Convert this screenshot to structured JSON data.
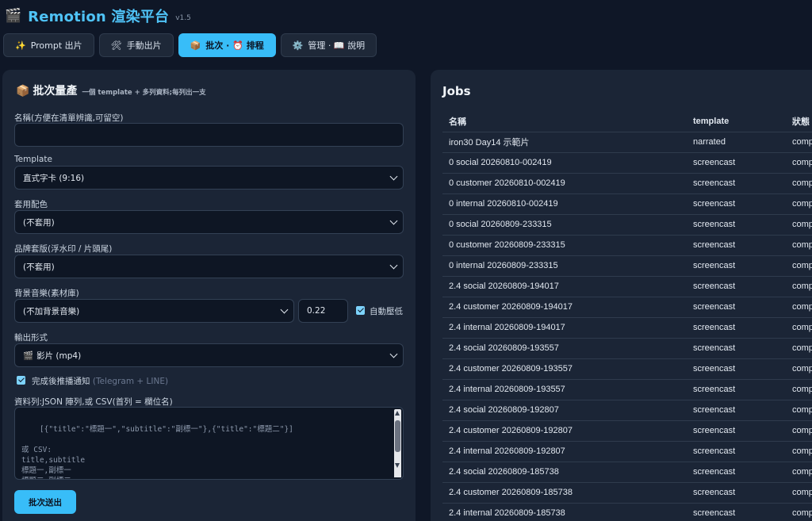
{
  "app": {
    "logo_icon": "🎬",
    "title": "Remotion 渲染平台",
    "version": "v1.5"
  },
  "tabs": [
    {
      "icon": "✨",
      "label": "Prompt 出片",
      "active": false
    },
    {
      "icon": "🛠",
      "label": "手動出片",
      "active": false
    },
    {
      "icon": "📦",
      "label": "批次 · ⏰ 排程",
      "active": true
    },
    {
      "icon": "⚙️",
      "label": "管理 · 📖 說明",
      "active": false
    }
  ],
  "batch_form": {
    "title_icon": "📦",
    "title": "批次量產",
    "subtitle": "一個 template + 多列資料;每列出一支",
    "name_label": "名稱(方便在清單辨識,可留空)",
    "name_value": "",
    "template_label": "Template",
    "template_value": "直式字卡 (9:16)",
    "palette_label": "套用配色",
    "palette_value": "(不套用)",
    "brand_label": "品牌套版(浮水印 / 片頭尾)",
    "brand_value": "(不套用)",
    "bgm_label": "背景音樂(素材庫)",
    "bgm_value": "(不加背景音樂)",
    "volume_value": "0.22",
    "auto_duck_label": "自動壓低",
    "auto_duck_checked": true,
    "output_label": "輸出形式",
    "output_icon": "🎬",
    "output_value": "影片 (mp4)",
    "notify_checked": true,
    "notify_label": "完成後推播通知",
    "notify_hint": "(Telegram + LINE)",
    "data_label": "資料列:JSON 陣列,或 CSV(首列 = 欄位名)",
    "data_placeholder": "[{\"title\":\"標題一\",\"subtitle\":\"副標一\"},{\"title\":\"標題二\"}]\n\n或 CSV:\ntitle,subtitle\n標題一,副標一\n標題二,副標二",
    "submit_label": "批次送出"
  },
  "jobs": {
    "title": "Jobs",
    "columns": [
      "名稱",
      "template",
      "狀態"
    ],
    "rows": [
      {
        "name": "iron30 Day14 示範片",
        "template": "narrated",
        "status": "comp"
      },
      {
        "name": "0 social 20260810-002419",
        "template": "screencast",
        "status": "comp"
      },
      {
        "name": "0 customer 20260810-002419",
        "template": "screencast",
        "status": "comp"
      },
      {
        "name": "0 internal 20260810-002419",
        "template": "screencast",
        "status": "comp"
      },
      {
        "name": "0 social 20260809-233315",
        "template": "screencast",
        "status": "comp"
      },
      {
        "name": "0 customer 20260809-233315",
        "template": "screencast",
        "status": "comp"
      },
      {
        "name": "0 internal 20260809-233315",
        "template": "screencast",
        "status": "comp"
      },
      {
        "name": "2.4 social 20260809-194017",
        "template": "screencast",
        "status": "comp"
      },
      {
        "name": "2.4 customer 20260809-194017",
        "template": "screencast",
        "status": "comp"
      },
      {
        "name": "2.4 internal 20260809-194017",
        "template": "screencast",
        "status": "comp"
      },
      {
        "name": "2.4 social 20260809-193557",
        "template": "screencast",
        "status": "comp"
      },
      {
        "name": "2.4 customer 20260809-193557",
        "template": "screencast",
        "status": "comp"
      },
      {
        "name": "2.4 internal 20260809-193557",
        "template": "screencast",
        "status": "comp"
      },
      {
        "name": "2.4 social 20260809-192807",
        "template": "screencast",
        "status": "comp"
      },
      {
        "name": "2.4 customer 20260809-192807",
        "template": "screencast",
        "status": "comp"
      },
      {
        "name": "2.4 internal 20260809-192807",
        "template": "screencast",
        "status": "comp"
      },
      {
        "name": "2.4 social 20260809-185738",
        "template": "screencast",
        "status": "comp"
      },
      {
        "name": "2.4 customer 20260809-185738",
        "template": "screencast",
        "status": "comp"
      },
      {
        "name": "2.4 internal 20260809-185738",
        "template": "screencast",
        "status": "comp"
      }
    ]
  },
  "colors": {
    "accent": "#38bdf8",
    "title": "#4fc3f7",
    "status_completed": "#4ade80",
    "background": "#0f1727",
    "panel": "#1b2536"
  }
}
